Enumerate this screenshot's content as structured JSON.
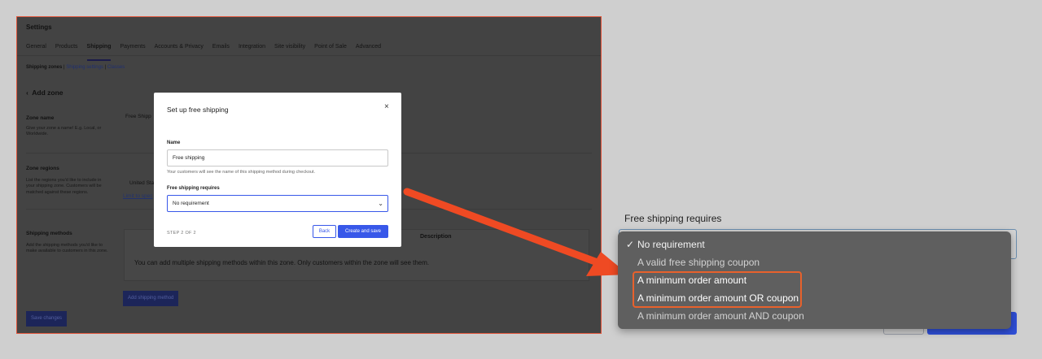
{
  "settings": {
    "title": "Settings",
    "tabs": [
      "General",
      "Products",
      "Shipping",
      "Payments",
      "Accounts & Privacy",
      "Emails",
      "Integration",
      "Site visibility",
      "Point of Sale",
      "Advanced"
    ],
    "active_tab": "Shipping",
    "breadcrumb": {
      "current": "Shipping zones",
      "links": [
        "Shipping settings",
        "Classes"
      ],
      "separator": "|"
    },
    "add_zone": "Add zone",
    "zone_name": {
      "label": "Zone name",
      "hint": "Give your zone a name! E.g. Local, or Worldwide.",
      "value_fragment": "Free Shipp"
    },
    "zone_regions": {
      "label": "Zone regions",
      "hint": "List the regions you'd like to include in your shipping zone. Customers will be matched against these regions.",
      "value_fragment": "United Sta",
      "link_fragment": "Limit to spec"
    },
    "shipping_methods": {
      "label": "Shipping methods",
      "hint": "Add the shipping methods you'd like to make available to customers in this zone.",
      "column_description": "Description",
      "empty_text": "You can add multiple shipping methods within this zone. Only customers within the zone will see them.",
      "add_button": "Add shipping method"
    },
    "save_button": "Save changes"
  },
  "modal": {
    "title": "Set up free shipping",
    "close_glyph": "×",
    "name_label": "Name",
    "name_value": "Free shipping",
    "name_help": "Your customers will see the name of this shipping method during checkout.",
    "requires_label": "Free shipping requires",
    "requires_value": "No requirement",
    "chevron_glyph": "⌄",
    "step": "STEP 2 OF 2",
    "back_button": "Back",
    "create_button": "Create and save"
  },
  "zoom": {
    "label": "Free shipping requires",
    "check_glyph": "✓",
    "options": [
      {
        "label": "No requirement",
        "selected": true,
        "highlighted": false
      },
      {
        "label": "A valid free shipping coupon",
        "selected": false,
        "highlighted": false
      },
      {
        "label": "A minimum order amount",
        "selected": false,
        "highlighted": true
      },
      {
        "label": "A minimum order amount OR coupon",
        "selected": false,
        "highlighted": true
      },
      {
        "label": "A minimum order amount AND coupon",
        "selected": false,
        "highlighted": false
      }
    ]
  },
  "colors": {
    "accent": "#3858e9",
    "highlight": "#e8612c",
    "arrow": "#ef4a23",
    "overlay": "#434343"
  }
}
